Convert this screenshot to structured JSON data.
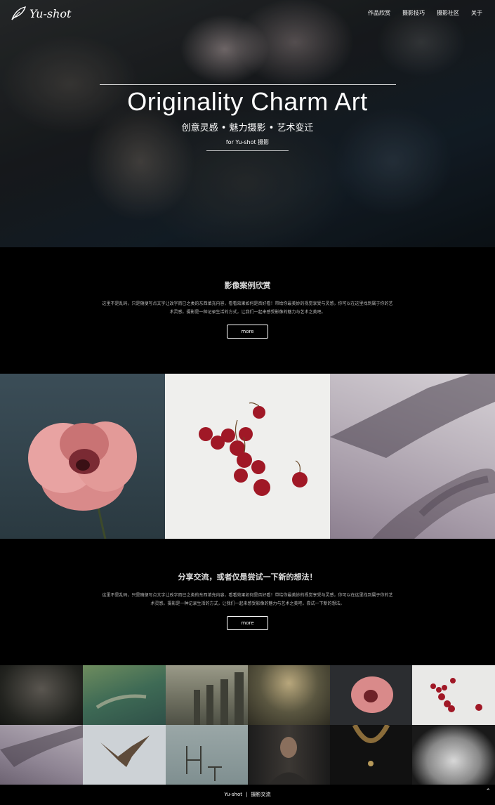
{
  "brand": {
    "name": "Yu-shot"
  },
  "nav": {
    "items": [
      "作品欣赏",
      "摄影技巧",
      "摄影社区",
      "关于"
    ]
  },
  "hero": {
    "title": "Originality Charm Art",
    "subtitle": "创意灵感 • 魅力摄影 • 艺术变迁",
    "tagline": "for Yu-shot 摄影"
  },
  "section1": {
    "title": "影像案例欣赏",
    "text": "这里不是乱码，只是随便写点文字让改字而已之类的东西填充内容，看看效果如何是否好看！带给你最美妙的视觉享受与灵感，你可以在这里找到属于你的艺术灵感。摄影是一种记录生活的方式，让我们一起来感受影像的魅力与艺术之美吧。",
    "more": "more"
  },
  "section2": {
    "title": "分享交流，或者仅是尝试一下新的想法！",
    "text": "这里不是乱码，只是随便写点文字让改字而已之类的东西填充内容，看看效果如何是否好看！带给你最美妙的视觉享受与灵感，你可以在这里找到属于你的艺术灵感。摄影是一种记录生活的方式，让我们一起来感受影像的魅力与艺术之美吧，尝试一下新的想法。",
    "more": "more"
  },
  "footer": {
    "brand": "Yu-shot",
    "sep": "|",
    "label": "摄影交流"
  },
  "icons": {
    "logo": "feather-icon",
    "totop": "chevron-up-icon"
  }
}
